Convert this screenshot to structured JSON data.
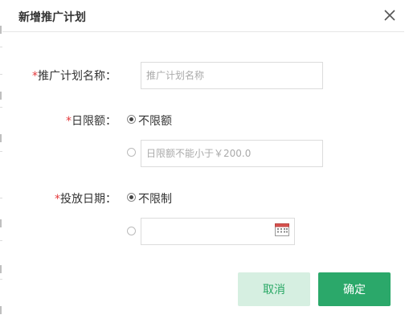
{
  "dialog": {
    "title": "新增推广计划",
    "close_icon": "close-icon"
  },
  "form": {
    "required_mark": "*",
    "name_label": "推广计划名称：",
    "name_placeholder": "推广计划名称",
    "limit_label": "日限额：",
    "limit_option_unlimited": "不限额",
    "limit_option_unlimited_selected": true,
    "limit_placeholder": "日限额不能小于￥200.0",
    "date_label": "投放日期：",
    "date_option_unlimited": "不限制",
    "date_option_unlimited_selected": true,
    "date_value": "",
    "calendar_icon": "calendar-icon"
  },
  "buttons": {
    "cancel": "取消",
    "confirm": "确定"
  },
  "colors": {
    "required": "#e4393c",
    "primary": "#2ba86a",
    "primary_light": "#d6efe1"
  }
}
